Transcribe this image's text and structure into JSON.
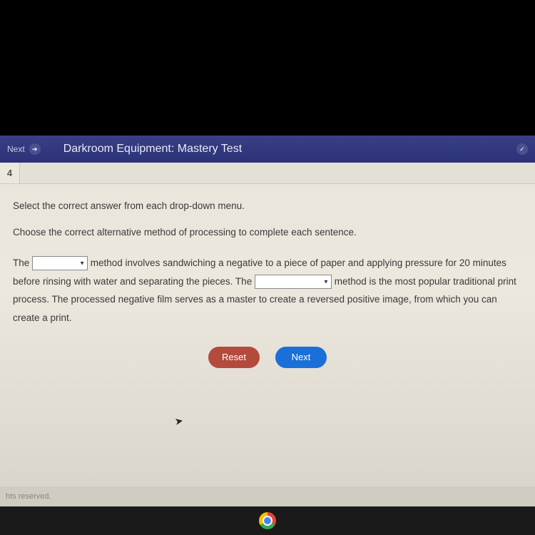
{
  "header": {
    "nav_label": "Next",
    "title": "Darkroom Equipment: Mastery Test"
  },
  "question_nav": {
    "current": "4"
  },
  "content": {
    "instruction": "Select the correct answer from each drop-down menu.",
    "sub_instruction": "Choose the correct alternative method of processing to complete each sentence.",
    "passage_pre1": "The ",
    "passage_mid1": " method involves sandwiching a negative to a piece of paper and applying pressure for 20 minutes before rinsing with water and separating the pieces. The ",
    "passage_mid2": " method is the most popular traditional print process. The processed negative film serves as a master to create a reversed positive image, from which you can create a print."
  },
  "buttons": {
    "reset": "Reset",
    "next": "Next"
  },
  "footer": {
    "text": "hts reserved."
  }
}
